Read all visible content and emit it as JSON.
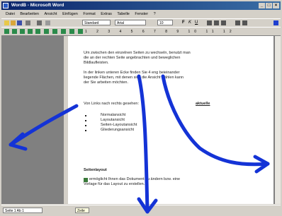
{
  "window": {
    "title": "WordB - Microsoft Word"
  },
  "menu": [
    "Datei",
    "Bearbeiten",
    "Ansicht",
    "Einfügen",
    "Format",
    "Extras",
    "Tabelle",
    "Fenster",
    "?"
  ],
  "formatting": {
    "style": "Standard",
    "font": "Arial",
    "size": "10"
  },
  "ruler": "1 2 3 4 5 6 7 8 9 10 11 12",
  "document": {
    "p1_line1": "Um zwischen den einzelnen Seiten zu wechseln, benutzt man",
    "p1_line2": "die an der rechten Seite angebrachten und beweglichen",
    "p1_line3": "Bildlaufleisten.",
    "p2_line1": "In der linken unteren Ecke finden Sie 4 eng beieinander",
    "p2_line2": "liegende Flächen, mit denen sich die Ansicht wählen kann",
    "p2_line3": "der Sie arbeiten möchten.",
    "p3_line1": "Von Links nach rechts gesehen:",
    "list": [
      "Normalansicht",
      "Layoutansicht",
      "Seiten-Layoutansicht",
      "Gliederungsansicht"
    ],
    "right_label": "aktuelle",
    "heading": "Seitenlayout",
    "p4_line1": "ermöglicht Ihnen das Dokument zu ändern bzw. eine",
    "p4_line2": "Vorlage für das Layout zu erstellen."
  },
  "status": {
    "page": "Seite 1 Ab 1",
    "mode": "Zeile"
  },
  "colors": {
    "arrows": "#1433d6",
    "titlebar": "#0a246a"
  }
}
